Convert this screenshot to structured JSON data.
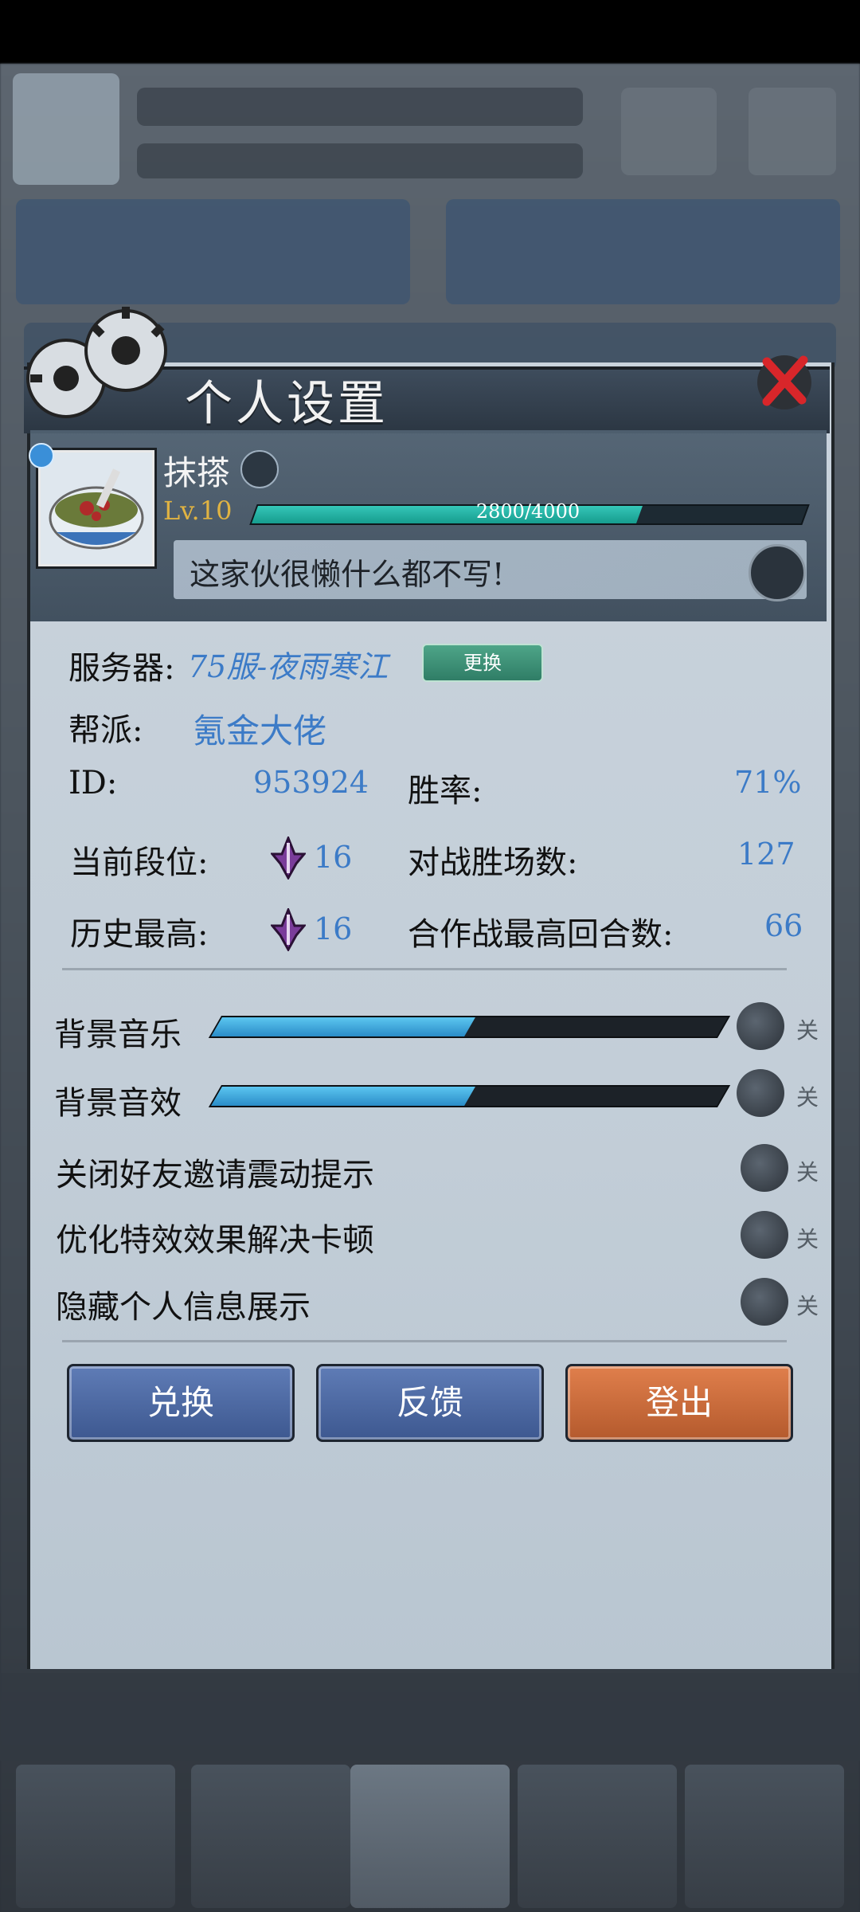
{
  "modal": {
    "title": "个人设置"
  },
  "profile": {
    "name": "抹搽",
    "level": "Lv.10",
    "xp_text": "2800/4000",
    "xp_fraction": 0.7,
    "signature": "这家伙很懒什么都不写!"
  },
  "info": {
    "server_label": "服务器:",
    "server_value": "75服-夜雨寒江",
    "change_button": "更换",
    "guild_label": "帮派:",
    "guild_value": "氪金大佬",
    "id_label": "ID:",
    "id_value": "953924",
    "winrate_label": "胜率:",
    "winrate_value": "71%",
    "current_rank_label": "当前段位:",
    "current_rank_value": "16",
    "battle_wins_label": "对战胜场数:",
    "battle_wins_value": "127",
    "best_rank_label": "历史最高:",
    "best_rank_value": "16",
    "coop_best_label": "合作战最高回合数:",
    "coop_best_value": "66"
  },
  "settings": {
    "bgm_label": "背景音乐",
    "bgm_level": 0.5,
    "bgm_state": "关",
    "sfx_label": "背景音效",
    "sfx_level": 0.5,
    "sfx_state": "关",
    "friend_invite_label": "关闭好友邀请震动提示",
    "friend_invite_state": "关",
    "optimize_label": "优化特效效果解决卡顿",
    "optimize_state": "关",
    "hide_info_label": "隐藏个人信息展示",
    "hide_info_state": "关"
  },
  "buttons": {
    "redeem": "兑换",
    "feedback": "反馈",
    "logout": "登出"
  },
  "colors": {
    "accent_blue": "#3c7bc7",
    "level_gold": "#e0b342",
    "xp_teal": "#35c7b8",
    "logout_orange": "#e07f4c"
  }
}
